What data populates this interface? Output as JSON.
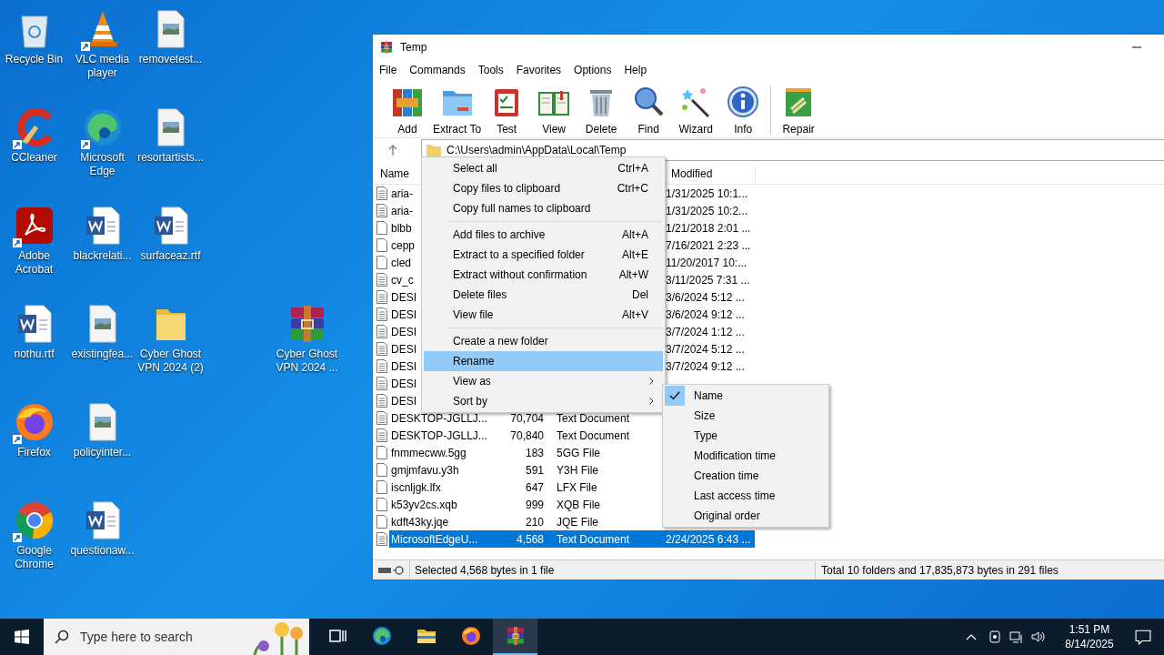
{
  "desktop_icons": [
    {
      "label": "Recycle Bin",
      "kind": "recycle",
      "shortcut": false
    },
    {
      "label": "VLC media player",
      "kind": "vlc",
      "shortcut": true
    },
    {
      "label": "removetest...",
      "kind": "image",
      "shortcut": false
    },
    {
      "label": "CCleaner",
      "kind": "ccleaner",
      "shortcut": true
    },
    {
      "label": "Microsoft Edge",
      "kind": "edge",
      "shortcut": true
    },
    {
      "label": "resortartists...",
      "kind": "image",
      "shortcut": false
    },
    {
      "label": "Adobe Acrobat",
      "kind": "pdf",
      "shortcut": true
    },
    {
      "label": "blackrelati...",
      "kind": "word",
      "shortcut": false
    },
    {
      "label": "surfaceaz.rtf",
      "kind": "word",
      "shortcut": false
    },
    {
      "label": "nothu.rtf",
      "kind": "word",
      "shortcut": false
    },
    {
      "label": "existingfea...",
      "kind": "image",
      "shortcut": false
    },
    {
      "label": "Cyber Ghost VPN 2024 (2)",
      "kind": "folder",
      "shortcut": false
    },
    {
      "label": "Cyber Ghost VPN 2024 ...",
      "kind": "winrar",
      "shortcut": false
    },
    {
      "label": "Firefox",
      "kind": "firefox",
      "shortcut": true
    },
    {
      "label": "policyinter...",
      "kind": "image",
      "shortcut": false
    },
    {
      "label": "Google Chrome",
      "kind": "chrome",
      "shortcut": true
    },
    {
      "label": "questionaw...",
      "kind": "word",
      "shortcut": false
    }
  ],
  "window": {
    "title": "Temp",
    "menu": [
      "File",
      "Commands",
      "Tools",
      "Favorites",
      "Options",
      "Help"
    ],
    "toolbar": [
      {
        "label": "Add",
        "kind": "add"
      },
      {
        "label": "Extract To",
        "kind": "extract"
      },
      {
        "label": "Test",
        "kind": "test"
      },
      {
        "label": "View",
        "kind": "view"
      },
      {
        "label": "Delete",
        "kind": "delete"
      },
      {
        "label": "Find",
        "kind": "find"
      },
      {
        "label": "Wizard",
        "kind": "wizard"
      },
      {
        "label": "Info",
        "kind": "info"
      },
      {
        "label": "Repair",
        "kind": "repair"
      }
    ],
    "address": "C:\\Users\\admin\\AppData\\Local\\Temp",
    "columns": [
      {
        "label": "Name",
        "kind": "name"
      },
      {
        "label": "Modified",
        "kind": "modified"
      }
    ],
    "rows": [
      {
        "kind": "text",
        "name": "aria-",
        "modified": "1/31/2025 10:1...",
        "selected": false
      },
      {
        "kind": "text",
        "name": "aria-",
        "modified": "1/31/2025 10:2...",
        "selected": false
      },
      {
        "kind": "blank",
        "name": "blbb",
        "modified": "1/21/2018 2:01 ...",
        "selected": false
      },
      {
        "kind": "blank",
        "name": "cepp",
        "modified": "7/16/2021 2:23 ...",
        "selected": false
      },
      {
        "kind": "blank",
        "name": "cled",
        "modified": "11/20/2017 10:...",
        "selected": false
      },
      {
        "kind": "text",
        "name": "cv_c",
        "modified": "3/11/2025 7:31 ...",
        "selected": false
      },
      {
        "kind": "text",
        "name": "DESI",
        "modified": "3/6/2024 5:12 ...",
        "selected": false
      },
      {
        "kind": "text",
        "name": "DESI",
        "modified": "3/6/2024 9:12 ...",
        "selected": false
      },
      {
        "kind": "text",
        "name": "DESI",
        "modified": "3/7/2024 1:12 ...",
        "selected": false
      },
      {
        "kind": "text",
        "name": "DESI",
        "modified": "3/7/2024 5:12 ...",
        "selected": false
      },
      {
        "kind": "text",
        "name": "DESI",
        "modified": "3/7/2024 9:12 ...",
        "selected": false
      },
      {
        "kind": "text",
        "name": "DESI",
        "selected": false
      },
      {
        "kind": "text",
        "name": "DESI",
        "selected": false
      },
      {
        "kind": "text",
        "name": "DESKTOP-JGLLJ...",
        "size": "70,704",
        "type": "Text Document",
        "selected": false
      },
      {
        "kind": "text",
        "name": "DESKTOP-JGLLJ...",
        "size": "70,840",
        "type": "Text Document",
        "selected": false
      },
      {
        "kind": "blank",
        "name": "fnmmecww.5gg",
        "size": "183",
        "type": "5GG File",
        "selected": false
      },
      {
        "kind": "blank",
        "name": "gmjmfavu.y3h",
        "size": "591",
        "type": "Y3H File",
        "selected": false
      },
      {
        "kind": "blank",
        "name": "iscnljgk.lfx",
        "size": "647",
        "type": "LFX File",
        "selected": false
      },
      {
        "kind": "blank",
        "name": "k53yv2cs.xqb",
        "size": "999",
        "type": "XQB File",
        "selected": false
      },
      {
        "kind": "blank",
        "name": "kdft43ky.jqe",
        "size": "210",
        "type": "JQE File",
        "selected": false
      },
      {
        "kind": "text",
        "name": "MicrosoftEdgeU...",
        "size": "4,568",
        "type": "Text Document",
        "modified": "2/24/2025 6:43 ...",
        "selected": true
      }
    ],
    "status": {
      "left": "Selected 4,568 bytes in 1 file",
      "right": "Total 10 folders and 17,835,873 bytes in 291 files"
    }
  },
  "context_menu": {
    "groups": [
      [
        {
          "label": "Select all",
          "shortcut": "Ctrl+A",
          "submenu": false,
          "selected": false
        },
        {
          "label": "Copy files to clipboard",
          "shortcut": "Ctrl+C",
          "submenu": false,
          "selected": false
        },
        {
          "label": "Copy full names to clipboard",
          "submenu": false,
          "selected": false
        }
      ],
      [
        {
          "label": "Add files to archive",
          "shortcut": "Alt+A",
          "submenu": false,
          "selected": false
        },
        {
          "label": "Extract to a specified folder",
          "shortcut": "Alt+E",
          "submenu": false,
          "selected": false
        },
        {
          "label": "Extract without confirmation",
          "shortcut": "Alt+W",
          "submenu": false,
          "selected": false
        },
        {
          "label": "Delete files",
          "shortcut": "Del",
          "submenu": false,
          "selected": false
        },
        {
          "label": "View file",
          "shortcut": "Alt+V",
          "submenu": false,
          "selected": false
        }
      ],
      [
        {
          "label": "Create a new folder",
          "submenu": false,
          "selected": false
        },
        {
          "label": "Rename",
          "submenu": false,
          "selected": true
        },
        {
          "label": "View as",
          "submenu": true,
          "selected": false
        },
        {
          "label": "Sort by",
          "submenu": true,
          "selected": false
        }
      ]
    ]
  },
  "sort_submenu": {
    "items": [
      {
        "label": "Name",
        "checked": true
      },
      {
        "label": "Size",
        "checked": false
      },
      {
        "label": "Type",
        "checked": false
      },
      {
        "label": "Modification time",
        "checked": false
      },
      {
        "label": "Creation time",
        "checked": false
      },
      {
        "label": "Last access time",
        "checked": false
      },
      {
        "label": "Original order",
        "checked": false
      }
    ]
  },
  "taskbar": {
    "search": {
      "placeholder": "Type here to search"
    },
    "apps": [
      {
        "kind": "taskview",
        "active": false
      },
      {
        "kind": "edge",
        "active": false
      },
      {
        "kind": "explorer",
        "active": false
      },
      {
        "kind": "firefox",
        "active": false
      },
      {
        "kind": "winrar",
        "active": true
      }
    ],
    "time": "1:51 PM",
    "date": "8/14/2025"
  }
}
